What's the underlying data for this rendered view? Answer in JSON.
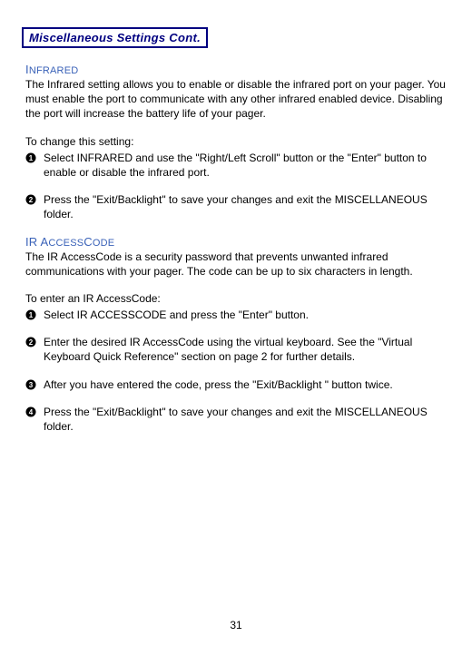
{
  "heading": "Miscellaneous Settings Cont.",
  "section1": {
    "title_cap1": "I",
    "title_rest1": "NFRARED",
    "para1": "The Infrared setting allows you to enable or disable the infrared port on your pager.  You must enable the port to communicate with any other infrared enabled device.  Disabling the port will increase the battery life of your pager.",
    "lead": "To change this setting:",
    "step1": "Select INFRARED and use the \"Right/Left Scroll\" button or the \"Enter\" button to enable or disable the infrared port.",
    "step2": "Press the \"Exit/Backlight\" to save your changes and exit the MISCELLANEOUS folder."
  },
  "section2": {
    "title_cap1": "IR A",
    "title_rest1": "CCESS",
    "title_cap2": "C",
    "title_rest2": "ODE",
    "para1": "The IR AccessCode is a security password that prevents unwanted infrared communications with your pager.  The code can be up to six characters in length.",
    "lead": "To enter an IR AccessCode:",
    "step1": "Select IR ACCESSCODE and press the \"Enter\" button.",
    "step2": "Enter the desired IR AccessCode using the virtual keyboard.  See the \"Virtual Keyboard Quick Reference\" section on page 2 for further details.",
    "step3": "After you have entered the code, press the \"Exit/Backlight \" button twice.",
    "step4": "Press the \"Exit/Backlight\" to save your changes and exit the MISCELLANEOUS folder."
  },
  "page_number": "31"
}
